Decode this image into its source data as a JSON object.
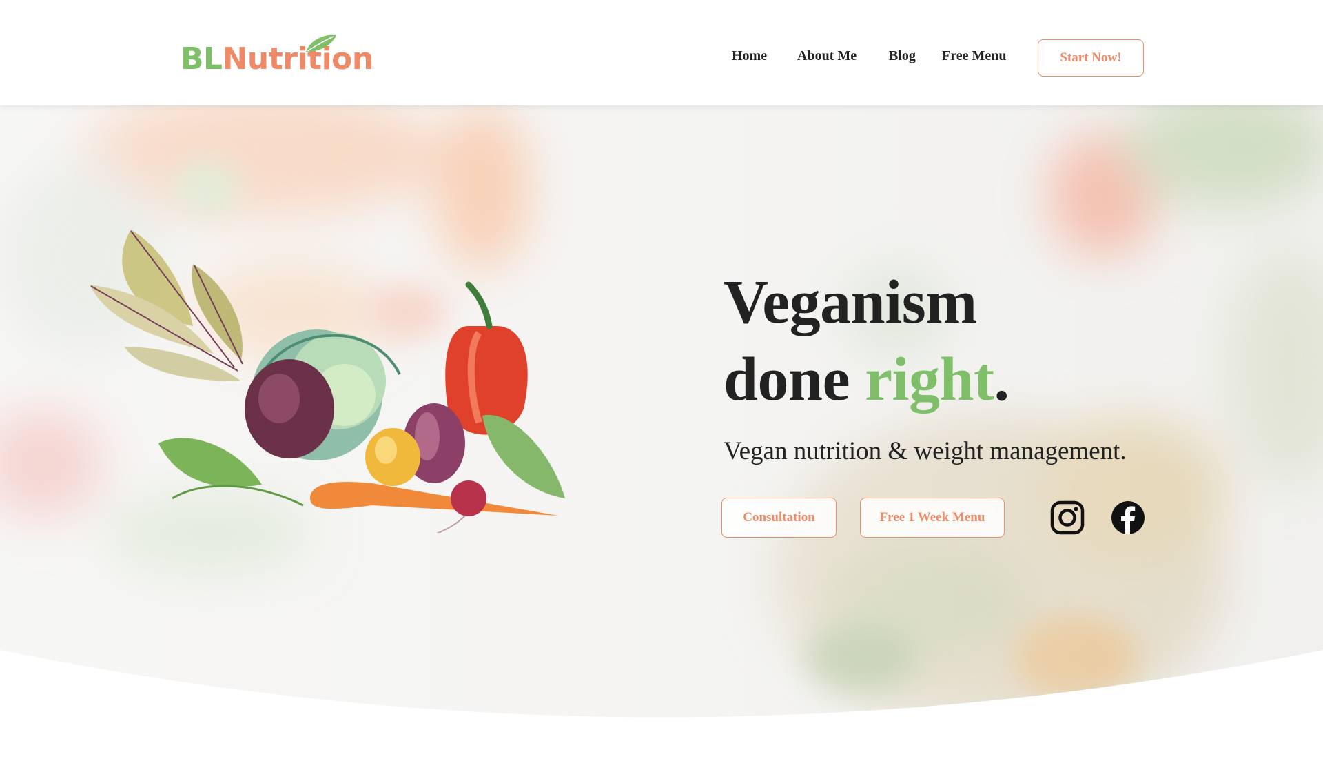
{
  "header": {
    "logo": {
      "part1": "BL",
      "part2": "Nutrition"
    },
    "nav": [
      {
        "label": "Home"
      },
      {
        "label": "About Me"
      },
      {
        "label": "Blog"
      },
      {
        "label": "Free Menu"
      }
    ],
    "cta_label": "Start Now!"
  },
  "hero": {
    "headline_line1": "Veganism",
    "headline_line2_a": "done ",
    "headline_line2_b": "right",
    "headline_line2_c": ".",
    "subheadline": "Vegan nutrition & weight management.",
    "buttons": [
      {
        "label": "Consultation"
      },
      {
        "label": "Free 1 Week Menu"
      }
    ],
    "social": [
      {
        "icon": "instagram-icon"
      },
      {
        "icon": "facebook-icon"
      }
    ]
  },
  "colors": {
    "green": "#7fbf6a",
    "salmon": "#ee8a68",
    "text": "#222222",
    "background": "#ffffff"
  }
}
